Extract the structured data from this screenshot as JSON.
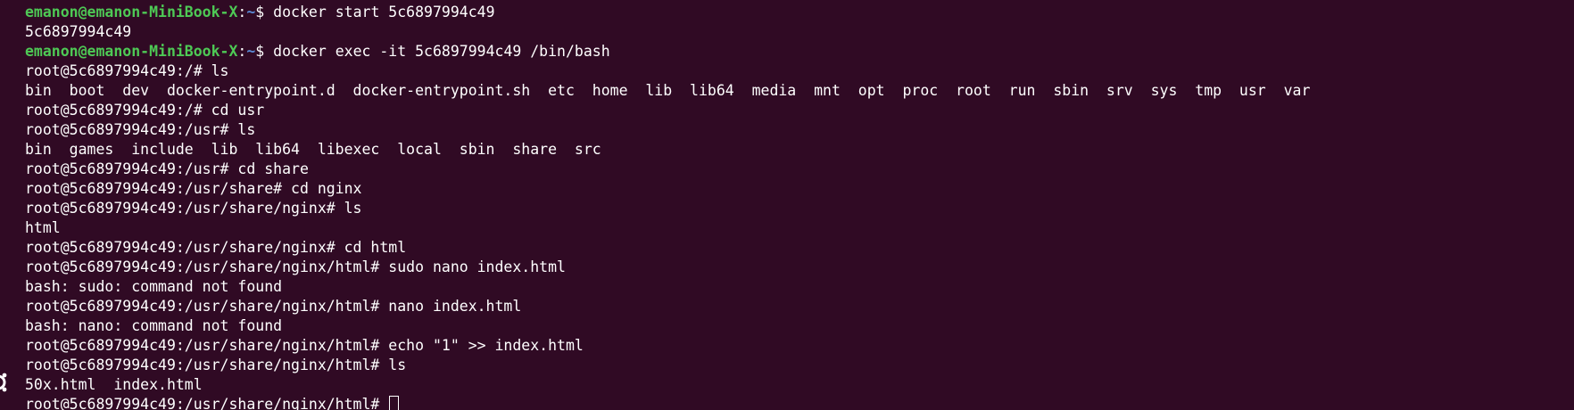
{
  "terminal": {
    "background": "#300a24",
    "colors": {
      "user": "#4ec955",
      "path": "#5b8bd6",
      "text": "#ffffff"
    },
    "prompt_user": {
      "user_host": "emanon@emanon-MiniBook-X",
      "cwd": "~"
    },
    "lines": [
      {
        "kind": "user-prompt",
        "command": "docker start 5c6897994c49"
      },
      {
        "kind": "output",
        "text": "5c6897994c49"
      },
      {
        "kind": "user-prompt",
        "command": "docker exec -it 5c6897994c49 /bin/bash"
      },
      {
        "kind": "root-prompt",
        "text": "root@5c6897994c49:/# ls"
      },
      {
        "kind": "output",
        "text": "bin  boot  dev  docker-entrypoint.d  docker-entrypoint.sh  etc  home  lib  lib64  media  mnt  opt  proc  root  run  sbin  srv  sys  tmp  usr  var"
      },
      {
        "kind": "root-prompt",
        "text": "root@5c6897994c49:/# cd usr"
      },
      {
        "kind": "root-prompt",
        "text": "root@5c6897994c49:/usr# ls"
      },
      {
        "kind": "output",
        "text": "bin  games  include  lib  lib64  libexec  local  sbin  share  src"
      },
      {
        "kind": "root-prompt",
        "text": "root@5c6897994c49:/usr# cd share"
      },
      {
        "kind": "root-prompt",
        "text": "root@5c6897994c49:/usr/share# cd nginx"
      },
      {
        "kind": "root-prompt",
        "text": "root@5c6897994c49:/usr/share/nginx# ls"
      },
      {
        "kind": "output",
        "text": "html"
      },
      {
        "kind": "root-prompt",
        "text": "root@5c6897994c49:/usr/share/nginx# cd html"
      },
      {
        "kind": "root-prompt",
        "text": "root@5c6897994c49:/usr/share/nginx/html# sudo nano index.html"
      },
      {
        "kind": "output",
        "text": "bash: sudo: command not found"
      },
      {
        "kind": "root-prompt",
        "text": "root@5c6897994c49:/usr/share/nginx/html# nano index.html"
      },
      {
        "kind": "output",
        "text": "bash: nano: command not found"
      },
      {
        "kind": "root-prompt",
        "text": "root@5c6897994c49:/usr/share/nginx/html# echo \"1\" >> index.html"
      },
      {
        "kind": "root-prompt",
        "text": "root@5c6897994c49:/usr/share/nginx/html# ls"
      },
      {
        "kind": "output",
        "text": "50x.html  index.html"
      },
      {
        "kind": "active-prompt",
        "text": "root@5c6897994c49:/usr/share/nginx/html# "
      }
    ]
  }
}
